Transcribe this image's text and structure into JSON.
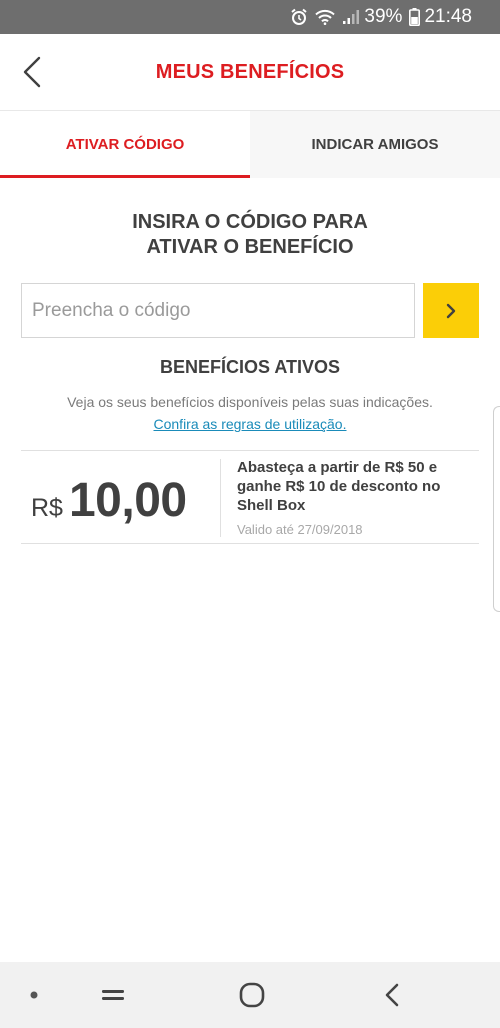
{
  "status_bar": {
    "battery": "39%",
    "time": "21:48",
    "icons": [
      "alarm-icon",
      "wifi-icon",
      "signal-icon",
      "battery-icon"
    ]
  },
  "header": {
    "title": "MEUS BENEFÍCIOS",
    "back_icon": "chevron-left-icon"
  },
  "tabs": [
    {
      "label": "ATIVAR CÓDIGO",
      "active": true
    },
    {
      "label": "INDICAR AMIGOS",
      "active": false
    }
  ],
  "activate": {
    "instruction_line1": "INSIRA O CÓDIGO PARA",
    "instruction_line2": "ATIVAR O BENEFÍCIO",
    "input_placeholder": "Preencha o código",
    "input_value": "",
    "submit_icon": "chevron-right-icon"
  },
  "benefits": {
    "title": "BENEFÍCIOS ATIVOS",
    "description": "Veja os seus benefícios disponíveis pelas suas indicações.",
    "rules_link": "Confira as regras de utilização.",
    "items": [
      {
        "currency": "R$",
        "amount": "10,00",
        "description": "Abasteça a partir de R$ 50 e ganhe R$ 10 de desconto no Shell Box",
        "validity": "Valido até 27/09/2018"
      }
    ]
  },
  "nav_bar": {
    "icons": [
      "dot-icon",
      "recent-apps-icon",
      "home-icon",
      "back-icon"
    ]
  },
  "colors": {
    "brand_red": "#dd1d21",
    "brand_yellow": "#fbce07",
    "link_blue": "#1a8bb9",
    "text_dark": "#404040"
  }
}
